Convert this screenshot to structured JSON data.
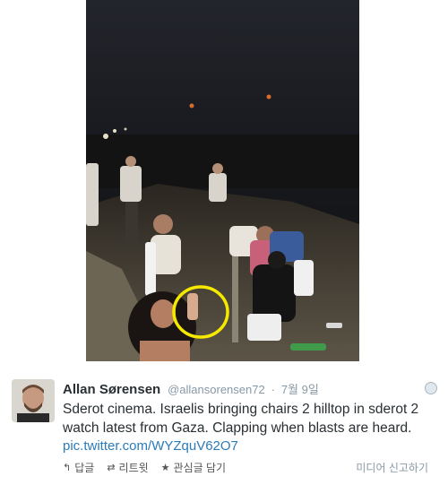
{
  "tweet": {
    "author_name": "Allan Sørensen",
    "handle": "@allansorensen72",
    "separator": "·",
    "date": "7월 9일",
    "text_lines": [
      "Sderot cinema. Israelis bringing chairs 2 hilltop in sderot 2",
      "watch latest from Gaza. Clapping when blasts are heard."
    ],
    "link": "pic.twitter.com/WYZquV62O7",
    "actions": {
      "reply": {
        "icon": "reply-icon",
        "label": "답글"
      },
      "retweet": {
        "icon": "retweet-icon",
        "label": "리트윗"
      },
      "favorite": {
        "icon": "star-icon",
        "label": "관심글 담기"
      }
    },
    "more_label": "미디어 신고하기"
  },
  "colors": {
    "name": "#292f33",
    "meta": "#8899a6",
    "link": "#2b7bb9",
    "highlight_circle": "#f5e900"
  }
}
